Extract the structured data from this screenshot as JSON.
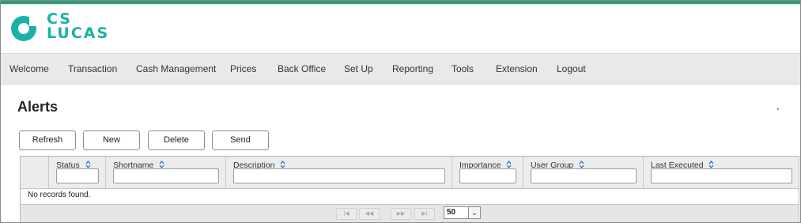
{
  "brand": {
    "line1": "CS",
    "line2": "LUCAS",
    "color": "#1bb0a7",
    "accent_bar": "#2e9a78"
  },
  "nav": {
    "items": [
      "Welcome",
      "Transaction",
      "Cash Management",
      "Prices",
      "Back Office",
      "Set Up",
      "Reporting",
      "Tools",
      "Extension",
      "Logout"
    ]
  },
  "page": {
    "title": "Alerts"
  },
  "toolbar": {
    "refresh": "Refresh",
    "new": "New",
    "delete": "Delete",
    "send": "Send"
  },
  "table": {
    "columns": [
      "Status",
      "Shortname",
      "Description",
      "Importance",
      "User Group",
      "Last Executed"
    ],
    "empty_message": "No records found."
  },
  "pager": {
    "rows_per_page": "50",
    "icons": [
      "first-page-icon",
      "previous-page-icon",
      "next-page-icon",
      "last-page-icon"
    ]
  }
}
